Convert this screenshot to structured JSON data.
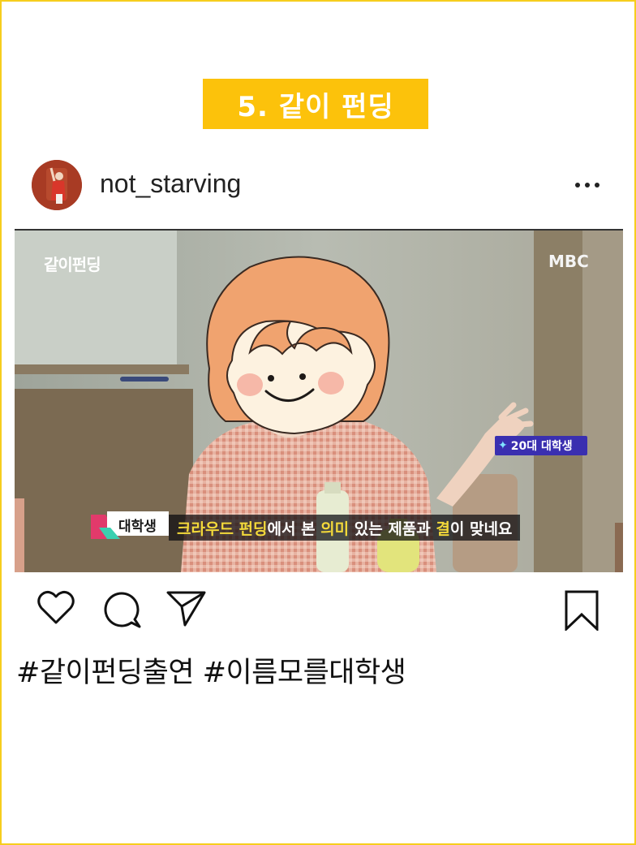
{
  "banner": {
    "title": "5. 같이 펀딩"
  },
  "post": {
    "username": "not_starving",
    "image": {
      "program_logo": "같이펀딩",
      "channel_logo": "MBC",
      "badge_label": "20대 대학생",
      "caption_tag": "대학생",
      "subtitle": {
        "part1": "크라우드 펀딩",
        "part2": "에서 본 ",
        "part3": "의미",
        "part4": " 있는 제품과 ",
        "part5": "결",
        "part6": "이 맞네요"
      }
    },
    "hashtags": "#같이펀딩출연 #이름모를대학생"
  },
  "colors": {
    "frame": "#f6cd1d",
    "banner_bg": "#fcc20b",
    "banner_text": "#ffffff",
    "subtitle_highlight": "#f3d93a",
    "badge_bg": "#3a2fb0"
  },
  "icons": [
    "more-icon",
    "heart-icon",
    "comment-icon",
    "share-icon",
    "bookmark-icon"
  ]
}
